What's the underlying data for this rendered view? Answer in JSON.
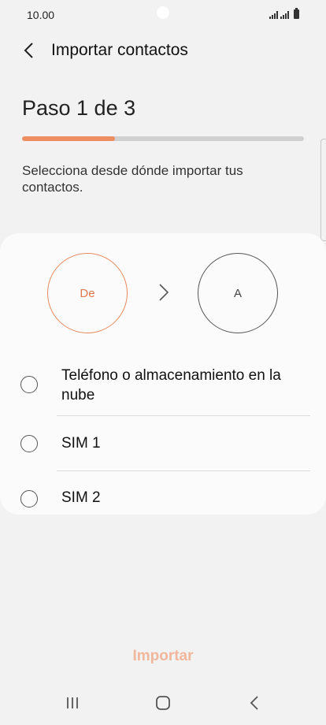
{
  "status_bar": {
    "time": "10.00",
    "icons": [
      "signal-icon",
      "signal-icon",
      "battery-icon"
    ]
  },
  "app_bar": {
    "back_icon": "chevron-left-icon",
    "title": "Importar contactos"
  },
  "step": {
    "title": "Paso 1 de 3",
    "progress_fraction": 0.33,
    "progress_color": "#ec8d62"
  },
  "description": "Selecciona desde dónde importar tus contactos.",
  "selector": {
    "from_label": "De",
    "to_label": "A",
    "arrow_icon": "chevron-right-icon",
    "accent_color": "#e0784b"
  },
  "options": [
    {
      "label": "Teléfono o almacenamiento en la nube",
      "selected": false
    },
    {
      "label": "SIM 1",
      "selected": false
    },
    {
      "label": "SIM 2",
      "selected": false
    }
  ],
  "import_button": {
    "label": "Importar",
    "enabled": false
  },
  "nav_bar": {
    "icons": [
      "recent-apps-icon",
      "home-icon",
      "back-icon"
    ]
  }
}
